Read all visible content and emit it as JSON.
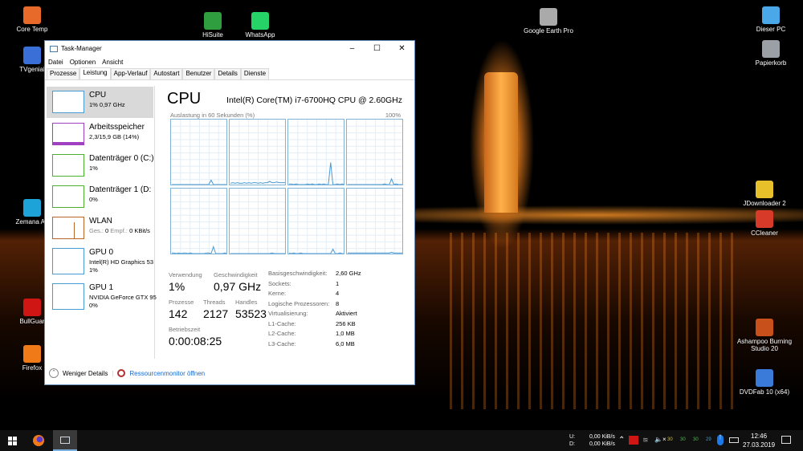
{
  "desktop": {
    "left": [
      {
        "label": "Core Temp",
        "color": "#e86a2a"
      },
      {
        "label": "TVgenial",
        "color": "#3a6fd8"
      },
      {
        "label": "Zemana An",
        "color": "#1ea3d8"
      },
      {
        "label": "BullGuar",
        "color": "#d01515"
      },
      {
        "label": "Firefox",
        "color": "#f07a18"
      }
    ],
    "top": [
      {
        "label": "HiSuite",
        "color": "#2e9e3f"
      },
      {
        "label": "WhatsApp",
        "color": "#25d366"
      },
      {
        "label": "Google Earth Pro",
        "color": "#aaaaaa"
      }
    ],
    "right": [
      {
        "label": "Dieser PC",
        "color": "#4aa8e8"
      },
      {
        "label": "Papierkorb",
        "color": "#9aa0a6"
      },
      {
        "label": "JDownloader 2",
        "color": "#e8c02a"
      },
      {
        "label": "CCleaner",
        "color": "#d83a2a"
      },
      {
        "label": "Ashampoo Burning Studio 20",
        "color": "#c8501a"
      },
      {
        "label": "DVDFab 10 (x64)",
        "color": "#3a7ad8"
      }
    ]
  },
  "window": {
    "title": "Task-Manager",
    "menu": [
      "Datei",
      "Optionen",
      "Ansicht"
    ],
    "tabs": [
      "Prozesse",
      "Leistung",
      "App-Verlauf",
      "Autostart",
      "Benutzer",
      "Details",
      "Dienste"
    ],
    "active_tab": "Leistung",
    "sidebar": [
      {
        "title": "CPU",
        "sub": "1% 0,97 GHz",
        "color": "#4a9ad4"
      },
      {
        "title": "Arbeitsspeicher",
        "sub": "2,3/15,9 GB (14%)",
        "color": "#a040c0"
      },
      {
        "title": "Datenträger 0 (C:)",
        "sub": "1%",
        "color": "#4caf30"
      },
      {
        "title": "Datenträger 1 (D:",
        "sub": "0%",
        "color": "#4caf30"
      },
      {
        "title": "WLAN",
        "sub_label1": "Ges.:",
        "sub_val1": "0",
        "sub_label2": "Empf.:",
        "sub_val2": "0 KBit/s",
        "color": "#b8652a"
      },
      {
        "title": "GPU 0",
        "sub": "Intel(R) HD Graphics 53",
        "sub2": "1%",
        "color": "#4a9ad4"
      },
      {
        "title": "GPU 1",
        "sub": "NVIDIA GeForce GTX 95",
        "sub2": "0%",
        "color": "#4a9ad4"
      }
    ],
    "main": {
      "title": "CPU",
      "cpu_name": "Intel(R) Core(TM) i7-6700HQ CPU @ 2.60GHz",
      "graph_label": "Auslastung in 60 Sekunden (%)",
      "graph_max": "100%",
      "stats": {
        "usage_label": "Verwendung",
        "usage": "1%",
        "speed_label": "Geschwindigkeit",
        "speed": "0,97 GHz",
        "proc_label": "Prozesse",
        "proc": "142",
        "threads_label": "Threads",
        "threads": "2127",
        "handles_label": "Handles",
        "handles": "53523",
        "uptime_label": "Betriebszeit",
        "uptime": "0:00:08:25"
      },
      "specs": [
        [
          "Basisgeschwindigkeit:",
          "2,60 GHz"
        ],
        [
          "Sockets:",
          "1"
        ],
        [
          "Kerne:",
          "4"
        ],
        [
          "Logische Prozessoren:",
          "8"
        ],
        [
          "Virtualisierung:",
          "Aktiviert"
        ],
        [
          "L1-Cache:",
          "256 KB"
        ],
        [
          "L2-Cache:",
          "1,0 MB"
        ],
        [
          "L3-Cache:",
          "6,0 MB"
        ]
      ]
    },
    "footer": {
      "less": "Weniger Details",
      "resmon": "Ressourcenmonitor öffnen"
    }
  },
  "chart_data": {
    "type": "line",
    "title": "Auslastung in 60 Sekunden (%)",
    "ylim": [
      0,
      100
    ],
    "series": [
      {
        "values": [
          0,
          0,
          0,
          0,
          0,
          0,
          0,
          0,
          0,
          0,
          0,
          0,
          0,
          0,
          0,
          0,
          0,
          7,
          0,
          0,
          0,
          0,
          0,
          0,
          0
        ]
      },
      {
        "values": [
          2,
          3,
          2,
          3,
          2,
          2,
          3,
          2,
          3,
          2,
          3,
          3,
          2,
          3,
          2,
          3,
          3,
          5,
          3,
          3,
          4,
          3,
          3,
          3,
          3
        ]
      },
      {
        "values": [
          1,
          1,
          0,
          1,
          0,
          0,
          0,
          0,
          1,
          0,
          1,
          0,
          0,
          1,
          0,
          1,
          0,
          0,
          35,
          0,
          0,
          1,
          0,
          1,
          0
        ]
      },
      {
        "values": [
          0,
          0,
          0,
          0,
          0,
          0,
          0,
          0,
          0,
          0,
          0,
          0,
          0,
          0,
          0,
          0,
          1,
          0,
          0,
          9,
          0,
          1,
          0,
          0,
          0
        ]
      },
      {
        "values": [
          1,
          1,
          0,
          1,
          0,
          1,
          1,
          0,
          1,
          0,
          0,
          0,
          0,
          0,
          0,
          1,
          1,
          0,
          11,
          0,
          0,
          0,
          0,
          1,
          0
        ]
      },
      {
        "values": [
          0,
          0,
          0,
          0,
          0,
          0,
          0,
          0,
          0,
          0,
          0,
          0,
          0,
          0,
          0,
          0,
          0,
          0,
          1,
          0,
          0,
          0,
          0,
          0,
          0
        ]
      },
      {
        "values": [
          1,
          0,
          1,
          0,
          0,
          1,
          0,
          0,
          0,
          0,
          0,
          0,
          0,
          0,
          0,
          0,
          0,
          0,
          0,
          7,
          0,
          0,
          1,
          0,
          0
        ]
      },
      {
        "values": [
          1,
          1,
          1,
          1,
          1,
          1,
          1,
          1,
          1,
          1,
          1,
          1,
          1,
          1,
          1,
          1,
          1,
          1,
          1,
          2,
          1,
          1,
          1,
          1,
          1
        ]
      }
    ]
  },
  "taskbar": {
    "up_label": "U:",
    "down_label": "D:",
    "up": "0,00 KiB/s",
    "down": "0,00 KiB/s",
    "temps": [
      "30",
      "30",
      "30",
      "29"
    ],
    "temp_colors": [
      "#d8c020",
      "#3ac83a",
      "#3ac83a",
      "#3a9ad8"
    ],
    "time": "12:46",
    "date": "27.03.2019"
  }
}
